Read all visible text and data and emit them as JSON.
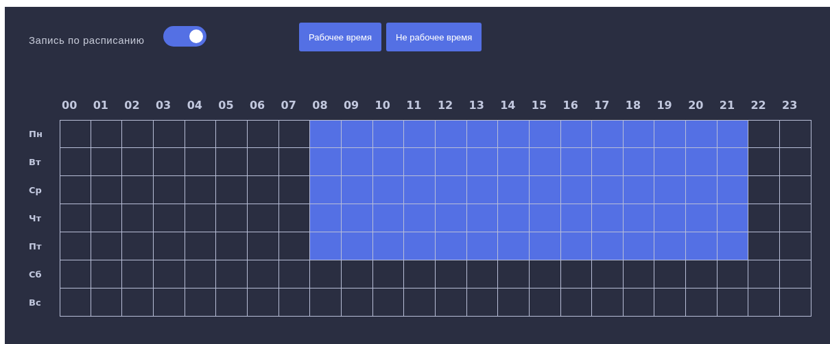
{
  "schedule_toggle": {
    "label": "Запись по расписанию",
    "on": true
  },
  "buttons": [
    "Рабочее время",
    "Не рабочее время"
  ],
  "hours": [
    "00",
    "01",
    "02",
    "03",
    "04",
    "05",
    "06",
    "07",
    "08",
    "09",
    "10",
    "11",
    "12",
    "13",
    "14",
    "15",
    "16",
    "17",
    "18",
    "19",
    "20",
    "21",
    "22",
    "23"
  ],
  "rows": [
    {
      "day": "Пн",
      "cells": [
        {
          "selected": false
        },
        {
          "selected": false
        },
        {
          "selected": false
        },
        {
          "selected": false
        },
        {
          "selected": false
        },
        {
          "selected": false
        },
        {
          "selected": false
        },
        {
          "selected": false
        },
        {
          "selected": true
        },
        {
          "selected": true
        },
        {
          "selected": true
        },
        {
          "selected": true
        },
        {
          "selected": true
        },
        {
          "selected": true
        },
        {
          "selected": true
        },
        {
          "selected": true
        },
        {
          "selected": true
        },
        {
          "selected": true
        },
        {
          "selected": true
        },
        {
          "selected": true
        },
        {
          "selected": true
        },
        {
          "selected": true
        },
        {
          "selected": false
        },
        {
          "selected": false
        }
      ]
    },
    {
      "day": "Вт",
      "cells": [
        {
          "selected": false
        },
        {
          "selected": false
        },
        {
          "selected": false
        },
        {
          "selected": false
        },
        {
          "selected": false
        },
        {
          "selected": false
        },
        {
          "selected": false
        },
        {
          "selected": false
        },
        {
          "selected": true
        },
        {
          "selected": true
        },
        {
          "selected": true
        },
        {
          "selected": true
        },
        {
          "selected": true
        },
        {
          "selected": true
        },
        {
          "selected": true
        },
        {
          "selected": true
        },
        {
          "selected": true
        },
        {
          "selected": true
        },
        {
          "selected": true
        },
        {
          "selected": true
        },
        {
          "selected": true
        },
        {
          "selected": true
        },
        {
          "selected": false
        },
        {
          "selected": false
        }
      ]
    },
    {
      "day": "Ср",
      "cells": [
        {
          "selected": false
        },
        {
          "selected": false
        },
        {
          "selected": false
        },
        {
          "selected": false
        },
        {
          "selected": false
        },
        {
          "selected": false
        },
        {
          "selected": false
        },
        {
          "selected": false
        },
        {
          "selected": true
        },
        {
          "selected": true
        },
        {
          "selected": true
        },
        {
          "selected": true
        },
        {
          "selected": true
        },
        {
          "selected": true
        },
        {
          "selected": true
        },
        {
          "selected": true
        },
        {
          "selected": true
        },
        {
          "selected": true
        },
        {
          "selected": true
        },
        {
          "selected": true
        },
        {
          "selected": true
        },
        {
          "selected": true
        },
        {
          "selected": false
        },
        {
          "selected": false
        }
      ]
    },
    {
      "day": "Чт",
      "cells": [
        {
          "selected": false
        },
        {
          "selected": false
        },
        {
          "selected": false
        },
        {
          "selected": false
        },
        {
          "selected": false
        },
        {
          "selected": false
        },
        {
          "selected": false
        },
        {
          "selected": false
        },
        {
          "selected": true
        },
        {
          "selected": true
        },
        {
          "selected": true
        },
        {
          "selected": true
        },
        {
          "selected": true
        },
        {
          "selected": true
        },
        {
          "selected": true
        },
        {
          "selected": true
        },
        {
          "selected": true
        },
        {
          "selected": true
        },
        {
          "selected": true
        },
        {
          "selected": true
        },
        {
          "selected": true
        },
        {
          "selected": true
        },
        {
          "selected": false
        },
        {
          "selected": false
        }
      ]
    },
    {
      "day": "Пт",
      "cells": [
        {
          "selected": false
        },
        {
          "selected": false
        },
        {
          "selected": false
        },
        {
          "selected": false
        },
        {
          "selected": false
        },
        {
          "selected": false
        },
        {
          "selected": false
        },
        {
          "selected": false
        },
        {
          "selected": true
        },
        {
          "selected": true
        },
        {
          "selected": true
        },
        {
          "selected": true
        },
        {
          "selected": true
        },
        {
          "selected": true
        },
        {
          "selected": true
        },
        {
          "selected": true
        },
        {
          "selected": true
        },
        {
          "selected": true
        },
        {
          "selected": true
        },
        {
          "selected": true
        },
        {
          "selected": true
        },
        {
          "selected": true
        },
        {
          "selected": false
        },
        {
          "selected": false
        }
      ]
    },
    {
      "day": "Сб",
      "cells": [
        {
          "selected": false
        },
        {
          "selected": false
        },
        {
          "selected": false
        },
        {
          "selected": false
        },
        {
          "selected": false
        },
        {
          "selected": false
        },
        {
          "selected": false
        },
        {
          "selected": false
        },
        {
          "selected": false
        },
        {
          "selected": false
        },
        {
          "selected": false
        },
        {
          "selected": false
        },
        {
          "selected": false
        },
        {
          "selected": false
        },
        {
          "selected": false
        },
        {
          "selected": false
        },
        {
          "selected": false
        },
        {
          "selected": false
        },
        {
          "selected": false
        },
        {
          "selected": false
        },
        {
          "selected": false
        },
        {
          "selected": false
        },
        {
          "selected": false
        },
        {
          "selected": false
        }
      ]
    },
    {
      "day": "Вс",
      "cells": [
        {
          "selected": false
        },
        {
          "selected": false
        },
        {
          "selected": false
        },
        {
          "selected": false
        },
        {
          "selected": false
        },
        {
          "selected": false
        },
        {
          "selected": false
        },
        {
          "selected": false
        },
        {
          "selected": false
        },
        {
          "selected": false
        },
        {
          "selected": false
        },
        {
          "selected": false
        },
        {
          "selected": false
        },
        {
          "selected": false
        },
        {
          "selected": false
        },
        {
          "selected": false
        },
        {
          "selected": false
        },
        {
          "selected": false
        },
        {
          "selected": false
        },
        {
          "selected": false
        },
        {
          "selected": false
        },
        {
          "selected": false
        },
        {
          "selected": false
        },
        {
          "selected": false
        }
      ]
    }
  ]
}
